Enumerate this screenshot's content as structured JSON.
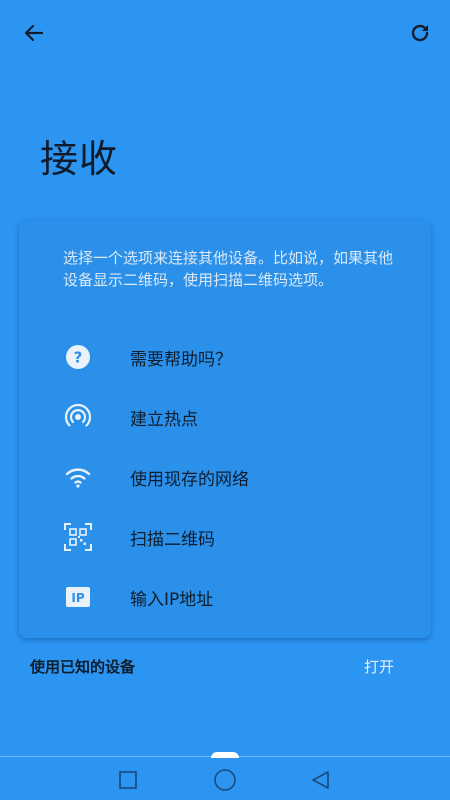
{
  "header": {
    "back_icon": "arrow-left-icon",
    "refresh_icon": "refresh-icon",
    "title": "接收"
  },
  "card": {
    "description": "选择一个选项来连接其他设备。比如说，如果其他设备显示二维码，使用扫描二维码选项。",
    "options": [
      {
        "icon": "help-circle-icon",
        "label": "需要帮助吗？"
      },
      {
        "icon": "hotspot-icon",
        "label": "建立热点"
      },
      {
        "icon": "wifi-icon",
        "label": "使用现存的网络"
      },
      {
        "icon": "qr-scan-icon",
        "label": "扫描二维码"
      },
      {
        "icon": "ip-icon",
        "label": "输入IP地址"
      }
    ]
  },
  "known_devices": {
    "label": "使用已知的设备",
    "action": "打开"
  },
  "ip_badge_text": "IP",
  "colors": {
    "background": "#2c95f2",
    "card": "#2a90ea",
    "text_dark": "#0f1d2d",
    "text_light": "#dde9f6"
  }
}
